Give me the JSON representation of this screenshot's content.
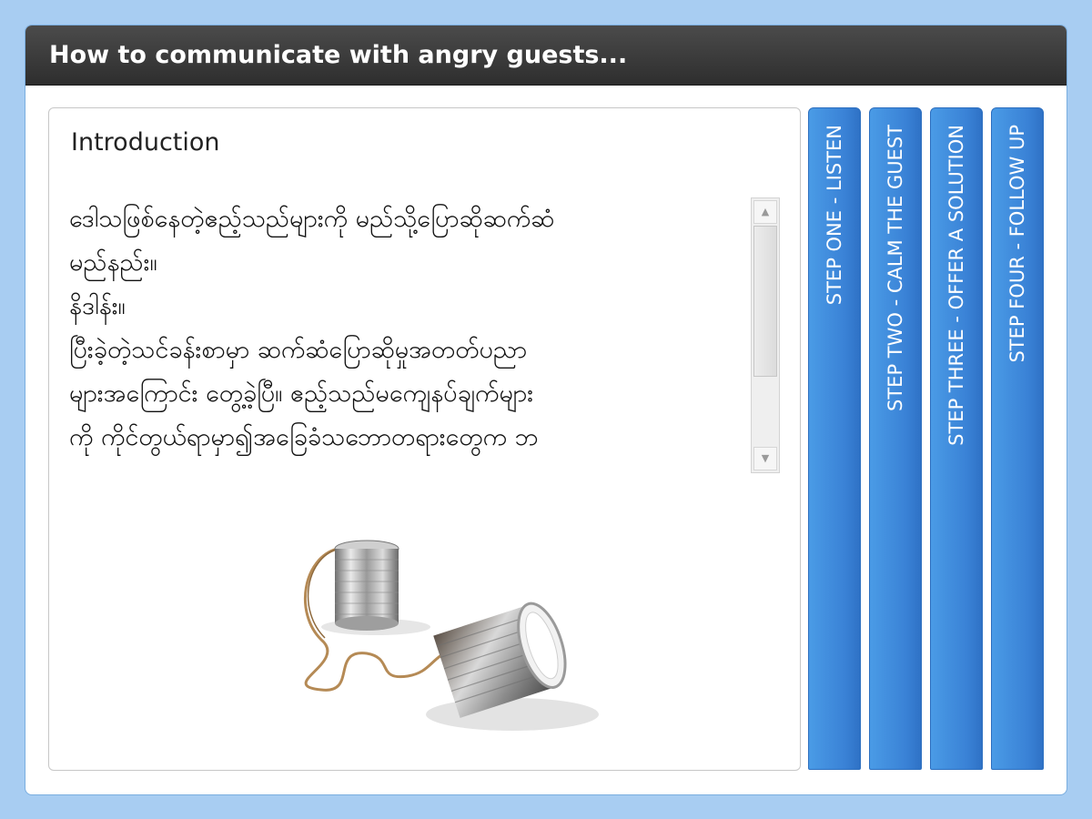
{
  "window": {
    "title": "How to communicate with angry guests..."
  },
  "content": {
    "section_title": "Introduction",
    "body_text": "ဒေါသဖြစ်နေတဲ့ဧည့်သည်များကို မည်သို့ပြောဆိုဆက်ဆံ\nမည်နည်း။\nနိဒါန်း။\nပြီးခဲ့တဲ့သင်ခန်းစာမှာ ဆက်ဆံပြောဆိုမှုအတတ်ပညာ\nများအကြောင်း တွေ့ခဲ့ပြီ။ ဧည့်သည်မကျေနပ်ချက်များ\nကို ကိုင်တွယ်ရာမှာ၍အခြေခံသဘောတရားတွေက ဘ",
    "image": "tin-can-telephone"
  },
  "tabs": [
    {
      "label": "STEP ONE - LISTEN"
    },
    {
      "label": "STEP TWO - CALM THE GUEST"
    },
    {
      "label": "STEP THREE - OFFER A SOLUTION"
    },
    {
      "label": "STEP FOUR - FOLLOW UP"
    }
  ],
  "scrollbar": {
    "up_icon": "up-arrow-icon",
    "down_icon": "down-arrow-icon"
  },
  "colors": {
    "background": "#a8cdf2",
    "titlebar": "#3a3a3a",
    "tab": "#3a82d6"
  }
}
